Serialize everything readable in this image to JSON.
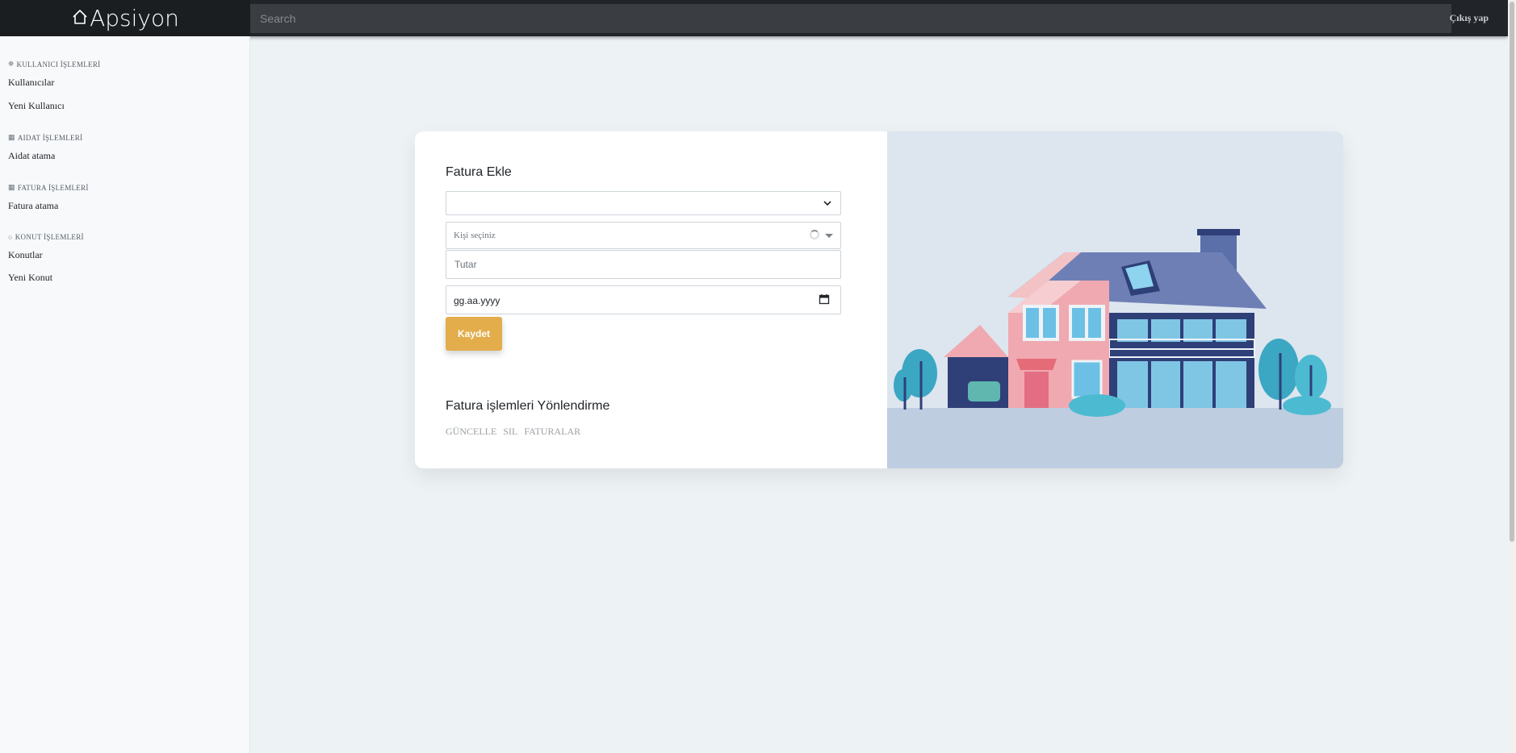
{
  "brand": {
    "name": "Apsiyon"
  },
  "search": {
    "placeholder": "Search"
  },
  "header": {
    "logout_label": "Çıkış yap"
  },
  "sidebar": {
    "sections": [
      {
        "title": "KULLANICI İŞLEMLERİ",
        "icon": "users-icon",
        "items": [
          "Kullanıcılar",
          "Yeni Kullanıcı"
        ]
      },
      {
        "title": "AIDAT İŞLEMLERİ",
        "icon": "calculator-icon",
        "items": [
          "Aidat atama"
        ]
      },
      {
        "title": "FATURA İŞLEMLERİ",
        "icon": "calculator-icon",
        "items": [
          "Fatura atama"
        ]
      },
      {
        "title": "KONUT İŞLEMLERİ",
        "icon": "circle-icon",
        "items": [
          "Konutlar",
          "Yeni Konut"
        ]
      }
    ]
  },
  "form": {
    "title": "Fatura Ekle",
    "type_select_value": "",
    "person_placeholder": "Kişi seçiniz",
    "amount_placeholder": "Tutar",
    "date_value": "gg.aa.yyyy",
    "save_label": "Kaydet"
  },
  "redirect": {
    "title": "Fatura işlemleri Yönlendirme",
    "links": [
      "GÜNCELLE",
      "SIL",
      "FATURALAR"
    ]
  },
  "colors": {
    "accent": "#e3ad4c",
    "topbar": "#212529",
    "background": "#edf2f5"
  }
}
